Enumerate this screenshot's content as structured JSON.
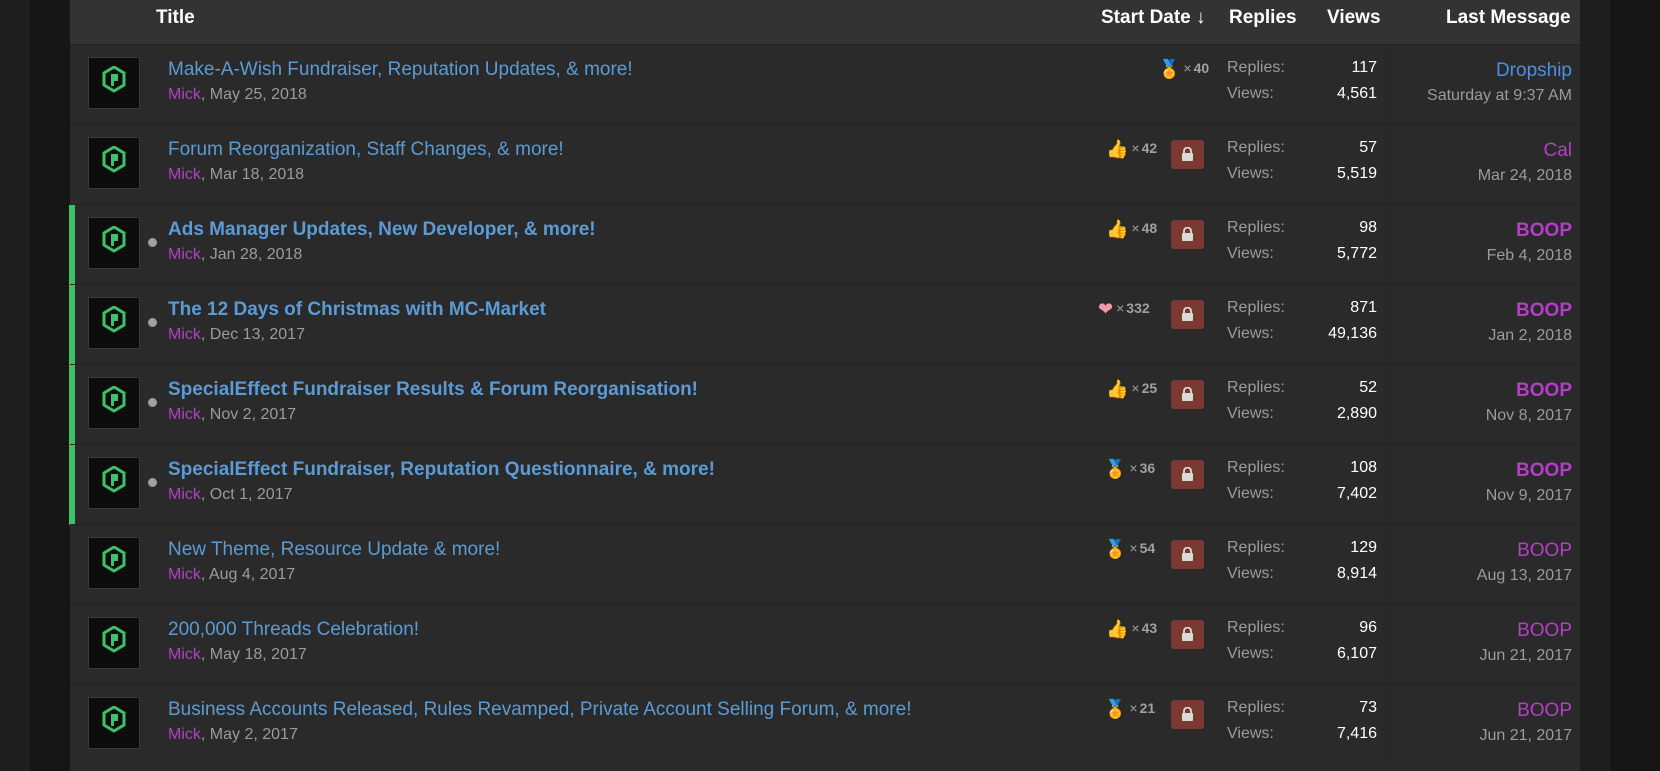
{
  "header": {
    "title": "Title",
    "start_date": "Start Date ↓",
    "replies": "Replies",
    "views": "Views",
    "last_message": "Last Message"
  },
  "labels": {
    "replies": "Replies:",
    "views": "Views:",
    "x": "×"
  },
  "colors": {
    "link": "#5b9bd5",
    "author": "#b23fc6",
    "unread_bar": "#3dc26a",
    "lock_bg": "#7a3a32",
    "last_user_blue": "#4a90e2",
    "last_user_purple": "#b23fc6"
  },
  "threads": [
    {
      "title": "Make-A-Wish Fundraiser, Reputation Updates, & more!",
      "author": "Mick",
      "date": ", May 25, 2018",
      "reaction_icon": "award-icon",
      "reaction_count": "40",
      "locked": false,
      "unread": false,
      "replies": "117",
      "views": "4,561",
      "last_user": "Dropship",
      "last_user_color": "#4a90e2",
      "last_date": "Saturday at 9:37 AM"
    },
    {
      "title": "Forum Reorganization, Staff Changes, & more!",
      "author": "Mick",
      "date": ", Mar 18, 2018",
      "reaction_icon": "thumbs-up-icon",
      "reaction_count": "42",
      "locked": true,
      "unread": false,
      "replies": "57",
      "views": "5,519",
      "last_user": "Cal",
      "last_user_color": "#b23fc6",
      "last_date": "Mar 24, 2018"
    },
    {
      "title": "Ads Manager Updates, New Developer, & more!",
      "author": "Mick",
      "date": ", Jan 28, 2018",
      "reaction_icon": "thumbs-up-icon",
      "reaction_count": "48",
      "locked": true,
      "unread": true,
      "replies": "98",
      "views": "5,772",
      "last_user": "BOOP",
      "last_user_color": "#b23fc6",
      "last_date": "Feb 4, 2018"
    },
    {
      "title": "The 12 Days of Christmas with MC-Market",
      "author": "Mick",
      "date": ", Dec 13, 2017",
      "reaction_icon": "heart-icon",
      "reaction_count": "332",
      "locked": true,
      "unread": true,
      "replies": "871",
      "views": "49,136",
      "last_user": "BOOP",
      "last_user_color": "#b23fc6",
      "last_date": "Jan 2, 2018"
    },
    {
      "title": "SpecialEffect Fundraiser Results & Forum Reorganisation!",
      "author": "Mick",
      "date": ", Nov 2, 2017",
      "reaction_icon": "thumbs-up-icon",
      "reaction_count": "25",
      "locked": true,
      "unread": true,
      "replies": "52",
      "views": "2,890",
      "last_user": "BOOP",
      "last_user_color": "#b23fc6",
      "last_date": "Nov 8, 2017"
    },
    {
      "title": "SpecialEffect Fundraiser, Reputation Questionnaire, & more!",
      "author": "Mick",
      "date": ", Oct 1, 2017",
      "reaction_icon": "award-icon",
      "reaction_count": "36",
      "locked": true,
      "unread": true,
      "replies": "108",
      "views": "7,402",
      "last_user": "BOOP",
      "last_user_color": "#b23fc6",
      "last_date": "Nov 9, 2017"
    },
    {
      "title": "New Theme, Resource Update & more!",
      "author": "Mick",
      "date": ", Aug 4, 2017",
      "reaction_icon": "award-icon",
      "reaction_count": "54",
      "locked": true,
      "unread": false,
      "replies": "129",
      "views": "8,914",
      "last_user": "BOOP",
      "last_user_color": "#b23fc6",
      "last_date": "Aug 13, 2017"
    },
    {
      "title": "200,000 Threads Celebration!",
      "author": "Mick",
      "date": ", May 18, 2017",
      "reaction_icon": "thumbs-up-icon",
      "reaction_count": "43",
      "locked": true,
      "unread": false,
      "replies": "96",
      "views": "6,107",
      "last_user": "BOOP",
      "last_user_color": "#b23fc6",
      "last_date": "Jun 21, 2017"
    },
    {
      "title": "Business Accounts Released, Rules Revamped, Private Account Selling Forum, & more!",
      "author": "Mick",
      "date": ", May 2, 2017",
      "reaction_icon": "award-icon",
      "reaction_count": "21",
      "locked": true,
      "unread": false,
      "replies": "73",
      "views": "7,416",
      "last_user": "BOOP",
      "last_user_color": "#b23fc6",
      "last_date": "Jun 21, 2017"
    }
  ]
}
